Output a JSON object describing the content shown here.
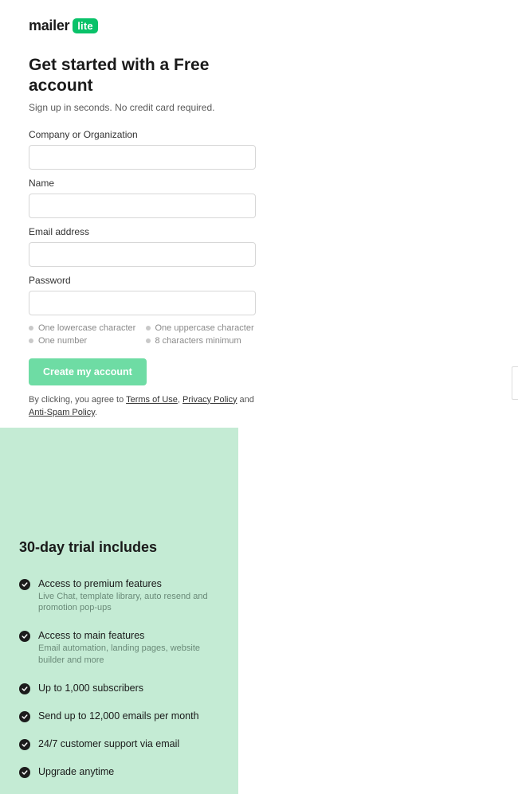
{
  "brand": {
    "name": "mailer",
    "badge": "lite"
  },
  "headline": "Get started with a Free account",
  "subtitle": "Sign up in seconds. No credit card required.",
  "fields": {
    "company": {
      "label": "Company or Organization",
      "value": ""
    },
    "name": {
      "label": "Name",
      "value": ""
    },
    "email": {
      "label": "Email address",
      "value": ""
    },
    "password": {
      "label": "Password",
      "value": ""
    }
  },
  "password_requirements": [
    "One lowercase character",
    "One uppercase character",
    "One number",
    "8 characters minimum"
  ],
  "submit_label": "Create my account",
  "terms": {
    "prefix": "By clicking, you agree to ",
    "link1": "Terms of Use",
    "sep1": ", ",
    "link2": "Privacy Policy",
    "sep2": " and ",
    "link3": "Anti-Spam Policy",
    "suffix": "."
  },
  "trial": {
    "heading": "30-day trial includes",
    "features": [
      {
        "title": "Access to premium features",
        "desc": "Live Chat, template library, auto resend and promotion pop-ups"
      },
      {
        "title": "Access to main features",
        "desc": "Email automation, landing pages, website builder and more"
      },
      {
        "title": "Up to 1,000 subscribers",
        "desc": ""
      },
      {
        "title": "Send up to 12,000 emails per month",
        "desc": ""
      },
      {
        "title": "24/7 customer support via email",
        "desc": ""
      },
      {
        "title": "Upgrade anytime",
        "desc": ""
      }
    ]
  },
  "colors": {
    "accent": "#09c269",
    "panel": "#c4ebd4",
    "button": "#6edca4"
  }
}
